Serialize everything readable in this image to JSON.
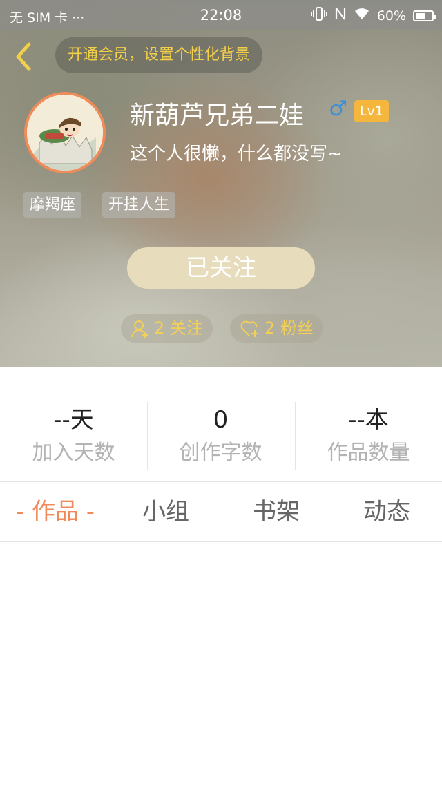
{
  "status_bar": {
    "carrier": "无 SIM 卡 ···",
    "time": "22:08",
    "battery": "60%"
  },
  "header": {
    "vip_prompt": "开通会员，设置个性化背景"
  },
  "profile": {
    "name": "新葫芦兄弟二娃",
    "gender_symbol": "♂",
    "level": "Lv1",
    "bio": "这个人很懒，什么都没写~",
    "tags": [
      "摩羯座",
      "开挂人生"
    ],
    "follow_button": "已关注",
    "following": "2 关注",
    "followers": "2 粉丝"
  },
  "stats": [
    {
      "value": "--天",
      "label": "加入天数"
    },
    {
      "value": "0",
      "label": "创作字数"
    },
    {
      "value": "--本",
      "label": "作品数量"
    }
  ],
  "tabs": [
    {
      "label": "- 作品 -",
      "active": true
    },
    {
      "label": "小组",
      "active": false
    },
    {
      "label": "书架",
      "active": false
    },
    {
      "label": "动态",
      "active": false
    }
  ],
  "colors": {
    "accent": "#f08a5a",
    "gold": "#f3cf55",
    "level_badge": "#f4b63c"
  }
}
